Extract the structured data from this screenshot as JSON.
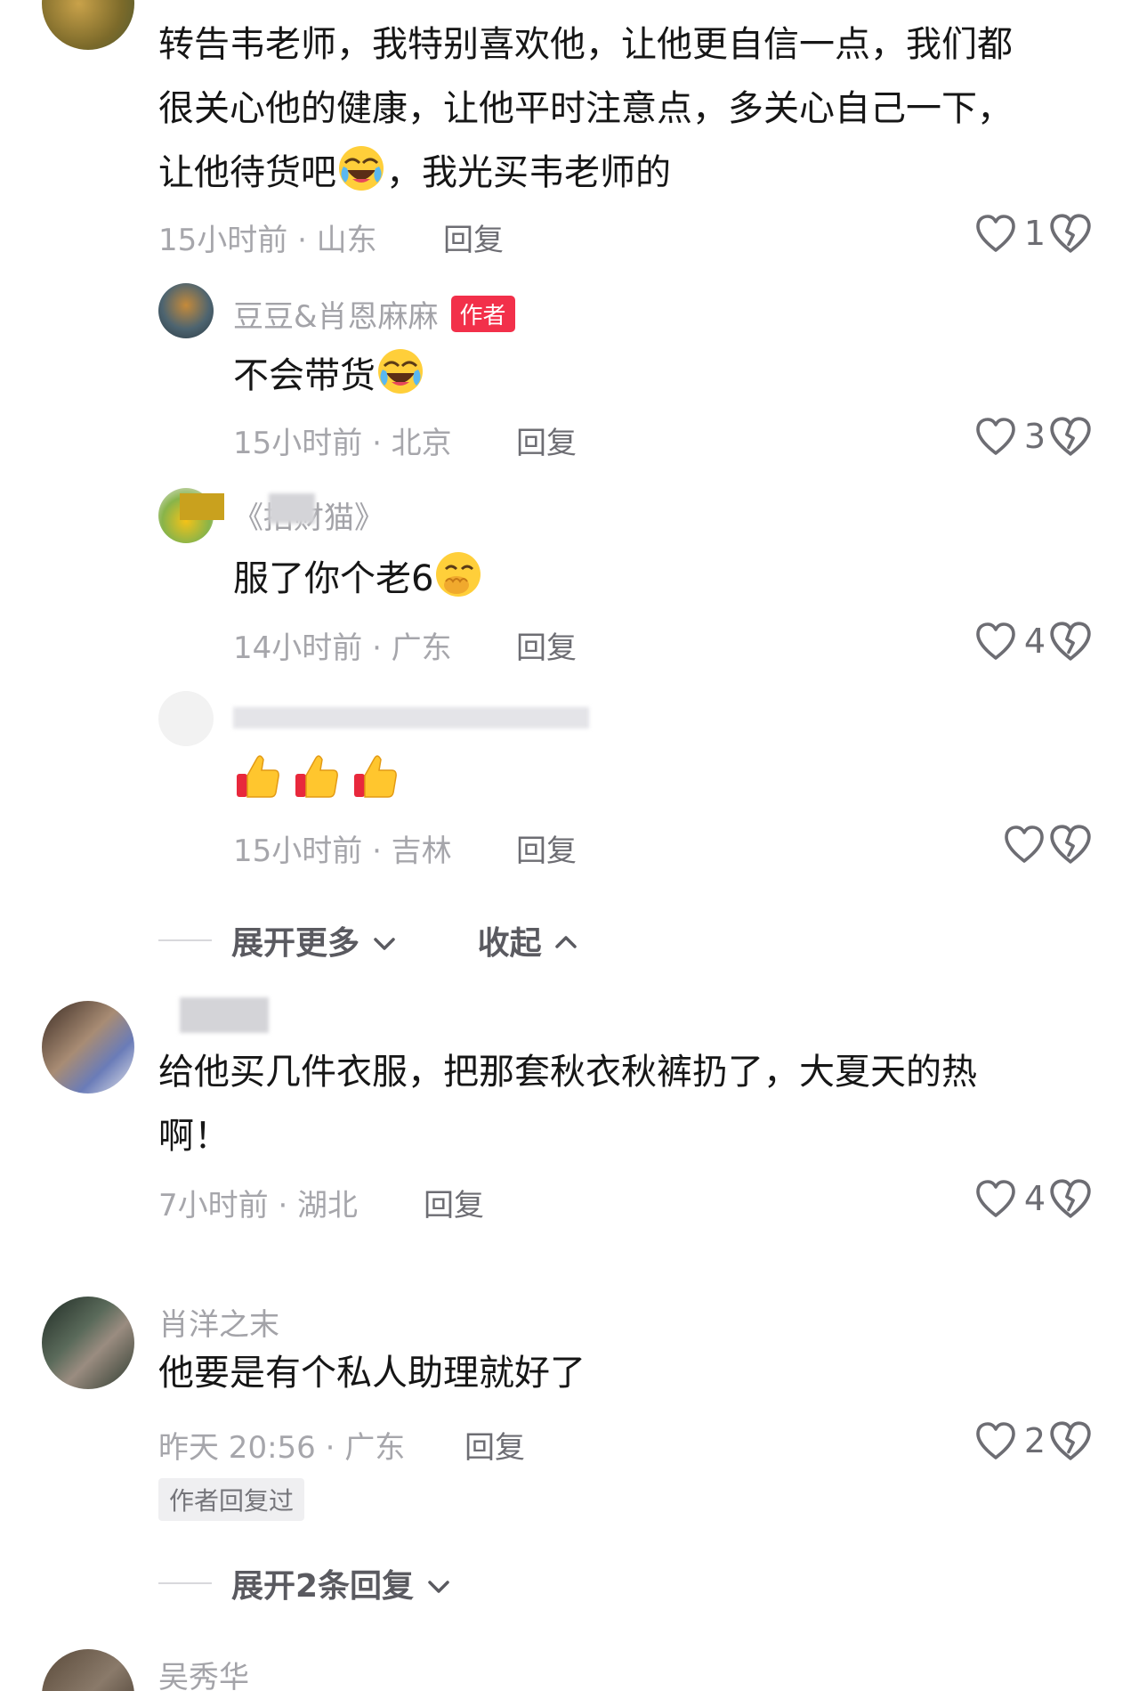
{
  "comments": [
    {
      "text_lines": [
        "转告韦老师，我特别喜欢他，让他更自信一点，我们都",
        "很关心他的健康，让他平时注意点，多关心自己一下，",
        "让他待货吧",
        "，我光买韦老师的"
      ],
      "meta": "15小时前 · 山东",
      "reply_label": "回复",
      "likes": "1"
    },
    {
      "username": "豆豆&肖恩麻麻",
      "badge": "作者",
      "text": "不会带货",
      "meta": "15小时前 · 北京",
      "reply_label": "回复",
      "likes": "3"
    },
    {
      "username": "《招财猫》",
      "text": "服了你个老6",
      "meta": "14小时前 · 广东",
      "reply_label": "回复",
      "likes": "4"
    },
    {
      "username": "",
      "text": "",
      "meta": "15小时前 · 吉林",
      "reply_label": "回复",
      "likes": ""
    },
    {
      "username": "",
      "text_lines": [
        "给他买几件衣服，把那套秋衣秋裤扔了，大夏天的热",
        "啊！"
      ],
      "meta": "7小时前 · 湖北",
      "reply_label": "回复",
      "likes": "4"
    },
    {
      "username": "肖洋之末",
      "text": "他要是有个私人助理就好了",
      "meta": "昨天 20:56 · 广东",
      "reply_label": "回复",
      "likes": "2",
      "author_replied": "作者回复过"
    },
    {
      "username": "吴秀华"
    }
  ],
  "expand": {
    "more": "展开更多",
    "collapse": "收起",
    "expand_replies": "展开2条回复"
  },
  "colors": {
    "badge": "#f2304a",
    "meta": "#a6a6ab",
    "text": "#161616"
  }
}
